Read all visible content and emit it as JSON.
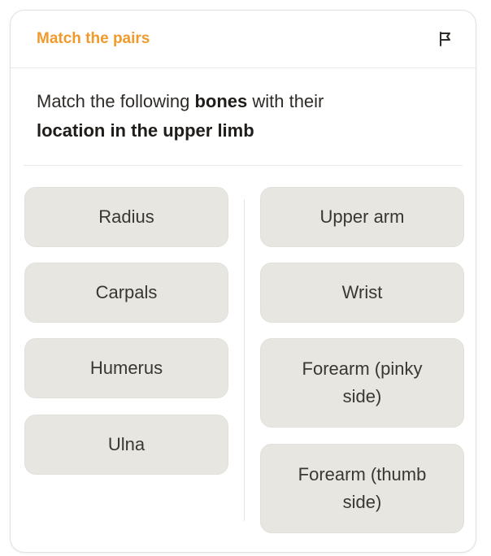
{
  "header": {
    "title": "Match the pairs",
    "flag_icon": "flag-icon"
  },
  "question": {
    "prefix": "Match the following ",
    "bold1": "bones",
    "middle": " with their",
    "bold2": "location in the upper limb"
  },
  "left_items": [
    "Radius",
    "Carpals",
    "Humerus",
    "Ulna"
  ],
  "right_items": [
    "Upper arm",
    "Wrist",
    "Forearm (pinky side)",
    "Forearm (thumb side)"
  ],
  "colors": {
    "accent": "#f19a2c",
    "tile_bg": "#e8e6e1",
    "text": "#2e2b28"
  }
}
